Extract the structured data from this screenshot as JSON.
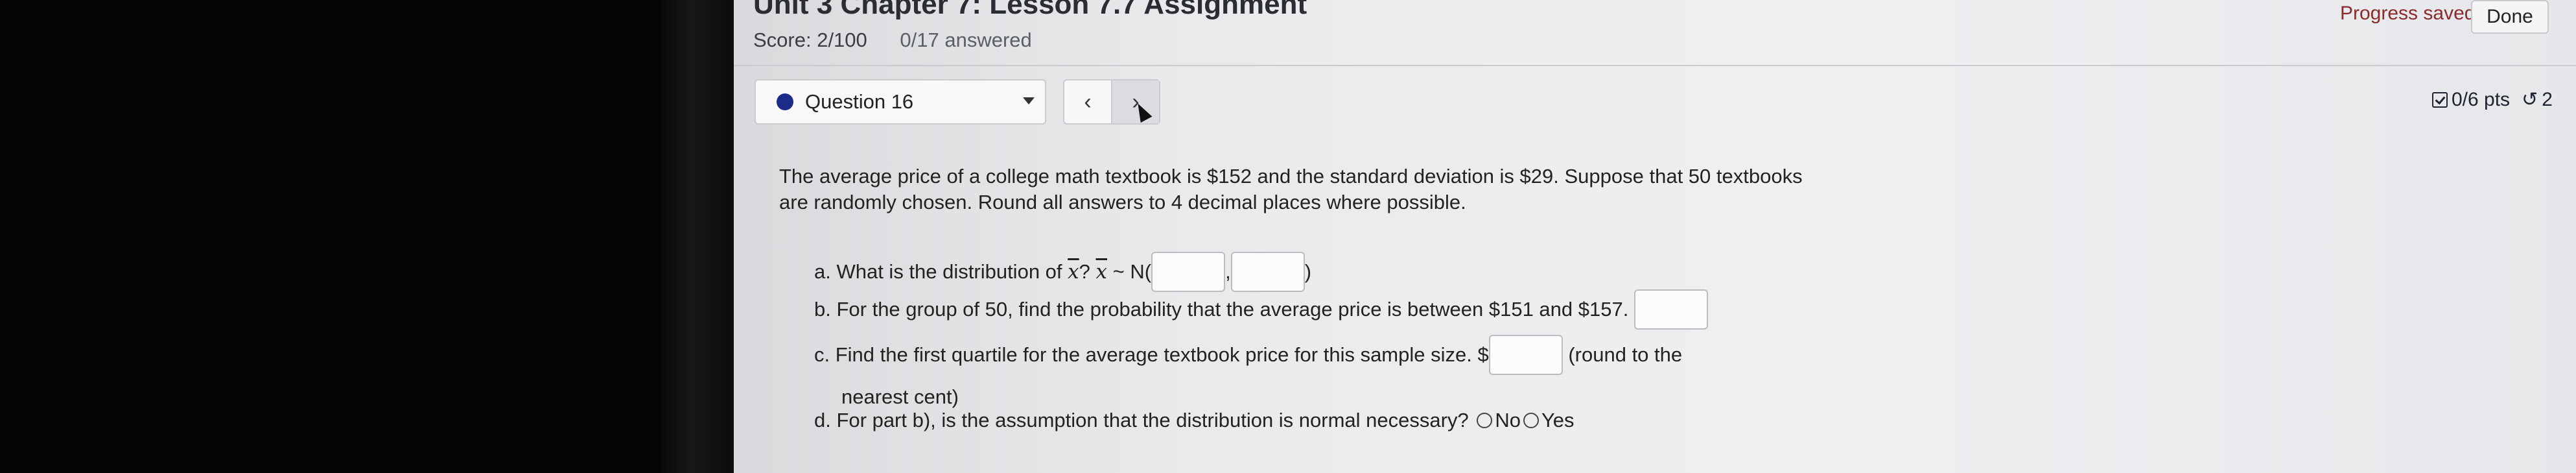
{
  "header": {
    "title": "Unit 3 Chapter 7: Lesson 7.7 Assignment",
    "score": "Score: 2/100",
    "answered": "0/17 answered",
    "progress": "Progress saved",
    "done": "Done"
  },
  "question": {
    "selector_label": "Question 16",
    "prev": "‹",
    "next": "›",
    "points": "0/6 pts",
    "retry_icon": "↺",
    "retry_count": "2",
    "problem_text": "The average price of a college math textbook is $152 and the standard deviation is $29. Suppose that 50 textbooks are randomly chosen. Round all answers to 4 decimal places where possible.",
    "parts": {
      "a": {
        "label": "a. What is the distribution of",
        "xbar": "x",
        "mid": "?",
        "xbar2": "x",
        "dist": "~ N(",
        "comma": ",",
        "close": ")"
      },
      "b": {
        "label": "b. For the group of 50, find the probability that the average price is between $151 and $157."
      },
      "c": {
        "label": "c. Find the first quartile for the average textbook price for this sample size. $",
        "suffix": "(round to the",
        "suffix2": "nearest cent)"
      },
      "d": {
        "label": "d. For part b), is the assumption that the distribution is normal necessary?",
        "opt_no": "No",
        "opt_yes": "Yes"
      }
    }
  }
}
